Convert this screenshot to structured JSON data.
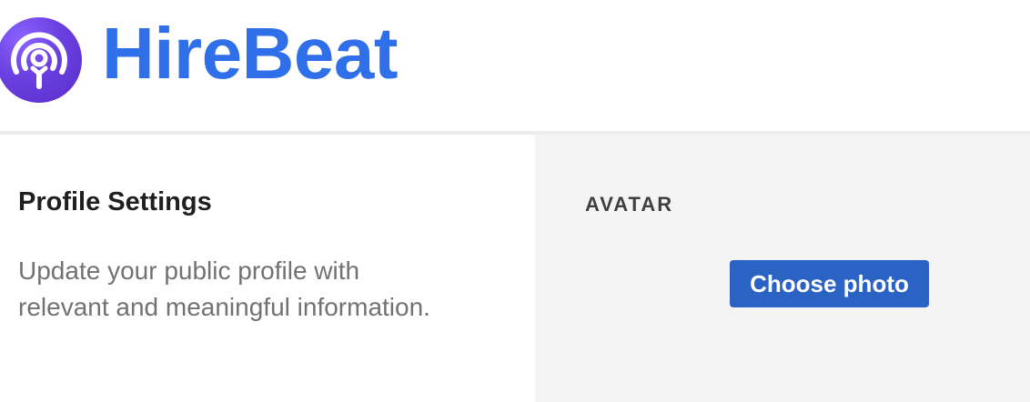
{
  "header": {
    "brand": "HireBeat",
    "logo_icon": "hirebeat-logo-icon",
    "brand_color": "#2f6fe9"
  },
  "profile": {
    "title": "Profile Settings",
    "description": "Update your public profile with relevant and meaningful information."
  },
  "avatar": {
    "label": "AVATAR",
    "choose_button": "Choose photo",
    "button_color": "#2a63c4"
  }
}
